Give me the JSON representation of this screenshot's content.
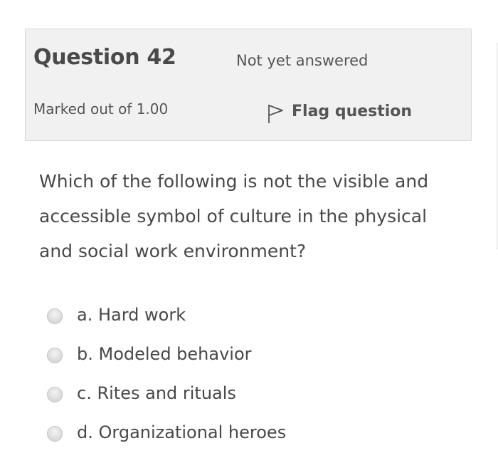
{
  "question": {
    "title": "Question 42",
    "state": "Not yet answered",
    "grade": "Marked out of 1.00",
    "flag_label": "Flag question",
    "text": "Which of the following is not the visible and accessible symbol of culture in the physical and social work environment?",
    "answers": [
      {
        "label": "a. Hard work"
      },
      {
        "label": "b. Modeled behavior"
      },
      {
        "label": "c. Rites and rituals"
      },
      {
        "label": "d. Organizational heroes"
      }
    ]
  },
  "icons": {
    "flag": "flag-icon",
    "radio": "radio-unselected"
  },
  "colors": {
    "info_background": "#f1f1f1",
    "info_border": "#d9d9d9",
    "text": "#484848"
  }
}
